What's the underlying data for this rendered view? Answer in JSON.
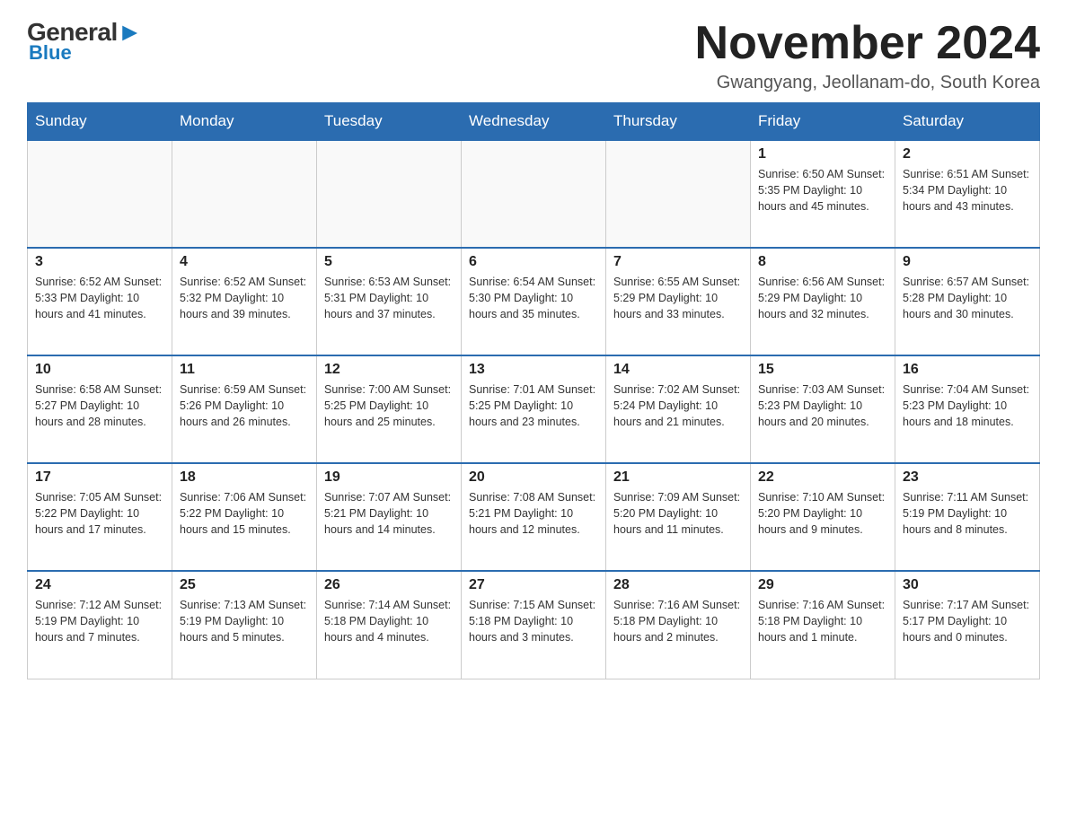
{
  "logo": {
    "general": "General",
    "blue": "Blue"
  },
  "title": "November 2024",
  "location": "Gwangyang, Jeollanam-do, South Korea",
  "days_of_week": [
    "Sunday",
    "Monday",
    "Tuesday",
    "Wednesday",
    "Thursday",
    "Friday",
    "Saturday"
  ],
  "weeks": [
    [
      {
        "day": "",
        "info": ""
      },
      {
        "day": "",
        "info": ""
      },
      {
        "day": "",
        "info": ""
      },
      {
        "day": "",
        "info": ""
      },
      {
        "day": "",
        "info": ""
      },
      {
        "day": "1",
        "info": "Sunrise: 6:50 AM\nSunset: 5:35 PM\nDaylight: 10 hours and 45 minutes."
      },
      {
        "day": "2",
        "info": "Sunrise: 6:51 AM\nSunset: 5:34 PM\nDaylight: 10 hours and 43 minutes."
      }
    ],
    [
      {
        "day": "3",
        "info": "Sunrise: 6:52 AM\nSunset: 5:33 PM\nDaylight: 10 hours and 41 minutes."
      },
      {
        "day": "4",
        "info": "Sunrise: 6:52 AM\nSunset: 5:32 PM\nDaylight: 10 hours and 39 minutes."
      },
      {
        "day": "5",
        "info": "Sunrise: 6:53 AM\nSunset: 5:31 PM\nDaylight: 10 hours and 37 minutes."
      },
      {
        "day": "6",
        "info": "Sunrise: 6:54 AM\nSunset: 5:30 PM\nDaylight: 10 hours and 35 minutes."
      },
      {
        "day": "7",
        "info": "Sunrise: 6:55 AM\nSunset: 5:29 PM\nDaylight: 10 hours and 33 minutes."
      },
      {
        "day": "8",
        "info": "Sunrise: 6:56 AM\nSunset: 5:29 PM\nDaylight: 10 hours and 32 minutes."
      },
      {
        "day": "9",
        "info": "Sunrise: 6:57 AM\nSunset: 5:28 PM\nDaylight: 10 hours and 30 minutes."
      }
    ],
    [
      {
        "day": "10",
        "info": "Sunrise: 6:58 AM\nSunset: 5:27 PM\nDaylight: 10 hours and 28 minutes."
      },
      {
        "day": "11",
        "info": "Sunrise: 6:59 AM\nSunset: 5:26 PM\nDaylight: 10 hours and 26 minutes."
      },
      {
        "day": "12",
        "info": "Sunrise: 7:00 AM\nSunset: 5:25 PM\nDaylight: 10 hours and 25 minutes."
      },
      {
        "day": "13",
        "info": "Sunrise: 7:01 AM\nSunset: 5:25 PM\nDaylight: 10 hours and 23 minutes."
      },
      {
        "day": "14",
        "info": "Sunrise: 7:02 AM\nSunset: 5:24 PM\nDaylight: 10 hours and 21 minutes."
      },
      {
        "day": "15",
        "info": "Sunrise: 7:03 AM\nSunset: 5:23 PM\nDaylight: 10 hours and 20 minutes."
      },
      {
        "day": "16",
        "info": "Sunrise: 7:04 AM\nSunset: 5:23 PM\nDaylight: 10 hours and 18 minutes."
      }
    ],
    [
      {
        "day": "17",
        "info": "Sunrise: 7:05 AM\nSunset: 5:22 PM\nDaylight: 10 hours and 17 minutes."
      },
      {
        "day": "18",
        "info": "Sunrise: 7:06 AM\nSunset: 5:22 PM\nDaylight: 10 hours and 15 minutes."
      },
      {
        "day": "19",
        "info": "Sunrise: 7:07 AM\nSunset: 5:21 PM\nDaylight: 10 hours and 14 minutes."
      },
      {
        "day": "20",
        "info": "Sunrise: 7:08 AM\nSunset: 5:21 PM\nDaylight: 10 hours and 12 minutes."
      },
      {
        "day": "21",
        "info": "Sunrise: 7:09 AM\nSunset: 5:20 PM\nDaylight: 10 hours and 11 minutes."
      },
      {
        "day": "22",
        "info": "Sunrise: 7:10 AM\nSunset: 5:20 PM\nDaylight: 10 hours and 9 minutes."
      },
      {
        "day": "23",
        "info": "Sunrise: 7:11 AM\nSunset: 5:19 PM\nDaylight: 10 hours and 8 minutes."
      }
    ],
    [
      {
        "day": "24",
        "info": "Sunrise: 7:12 AM\nSunset: 5:19 PM\nDaylight: 10 hours and 7 minutes."
      },
      {
        "day": "25",
        "info": "Sunrise: 7:13 AM\nSunset: 5:19 PM\nDaylight: 10 hours and 5 minutes."
      },
      {
        "day": "26",
        "info": "Sunrise: 7:14 AM\nSunset: 5:18 PM\nDaylight: 10 hours and 4 minutes."
      },
      {
        "day": "27",
        "info": "Sunrise: 7:15 AM\nSunset: 5:18 PM\nDaylight: 10 hours and 3 minutes."
      },
      {
        "day": "28",
        "info": "Sunrise: 7:16 AM\nSunset: 5:18 PM\nDaylight: 10 hours and 2 minutes."
      },
      {
        "day": "29",
        "info": "Sunrise: 7:16 AM\nSunset: 5:18 PM\nDaylight: 10 hours and 1 minute."
      },
      {
        "day": "30",
        "info": "Sunrise: 7:17 AM\nSunset: 5:17 PM\nDaylight: 10 hours and 0 minutes."
      }
    ]
  ]
}
